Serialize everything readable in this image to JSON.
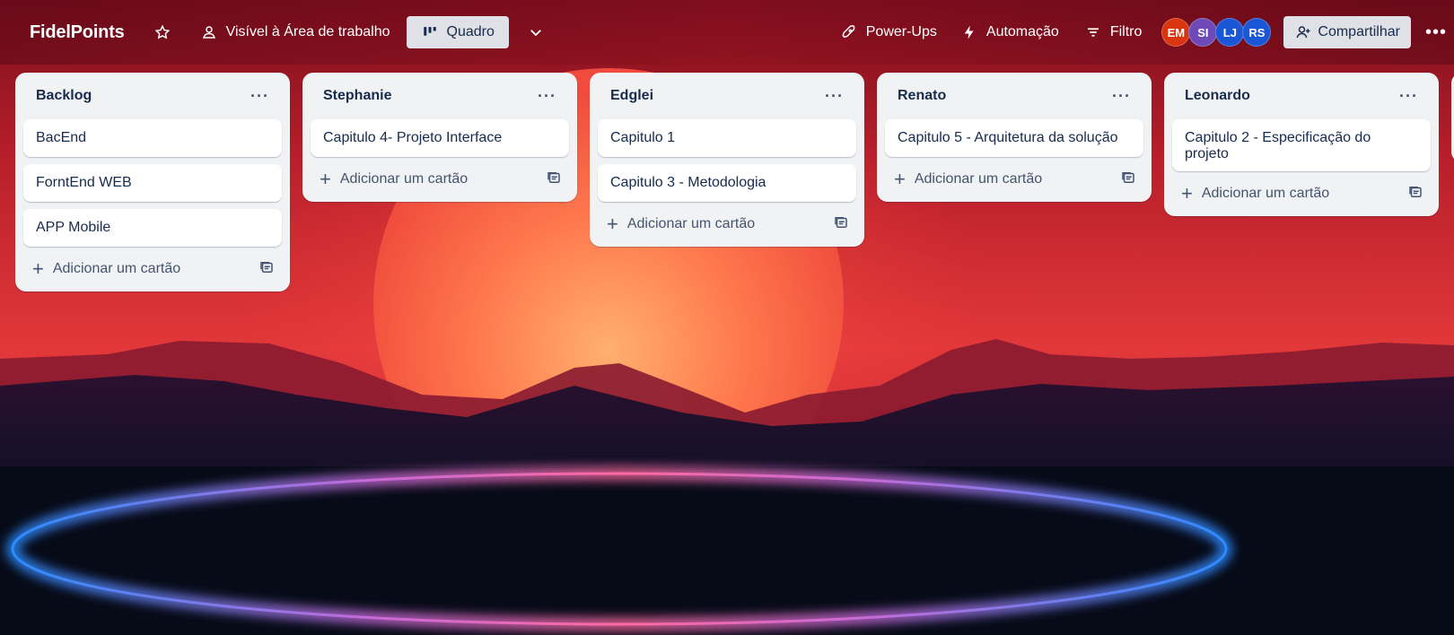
{
  "header": {
    "board_title": "FidelPoints",
    "visibility": "Visível à Área de trabalho",
    "view": "Quadro",
    "power_ups": "Power-Ups",
    "automation": "Automação",
    "filter": "Filtro",
    "share": "Compartilhar",
    "members": [
      {
        "initials": "EM",
        "color": "#d9350f"
      },
      {
        "initials": "SI",
        "color": "#6e4ab8"
      },
      {
        "initials": "LJ",
        "color": "#1b56d6"
      },
      {
        "initials": "RS",
        "color": "#1b56d6"
      }
    ]
  },
  "lists": [
    {
      "title": "Backlog",
      "cards": [
        "BacEnd",
        "ForntEnd WEB",
        "APP Mobile"
      ],
      "add_label": "Adicionar um cartão"
    },
    {
      "title": "Stephanie",
      "cards": [
        "Capitulo 4- Projeto Interface"
      ],
      "add_label": "Adicionar um cartão"
    },
    {
      "title": "Edglei",
      "cards": [
        "Capitulo 1",
        "Capitulo 3 - Metodologia"
      ],
      "add_label": "Adicionar um cartão"
    },
    {
      "title": "Renato",
      "cards": [
        "Capitulo 5 - Arquitetura da solução"
      ],
      "add_label": "Adicionar um cartão"
    },
    {
      "title": "Leonardo",
      "cards": [
        "Capitulo 2 - Especificação do projeto"
      ],
      "add_label": "Adicionar um cartão"
    }
  ]
}
